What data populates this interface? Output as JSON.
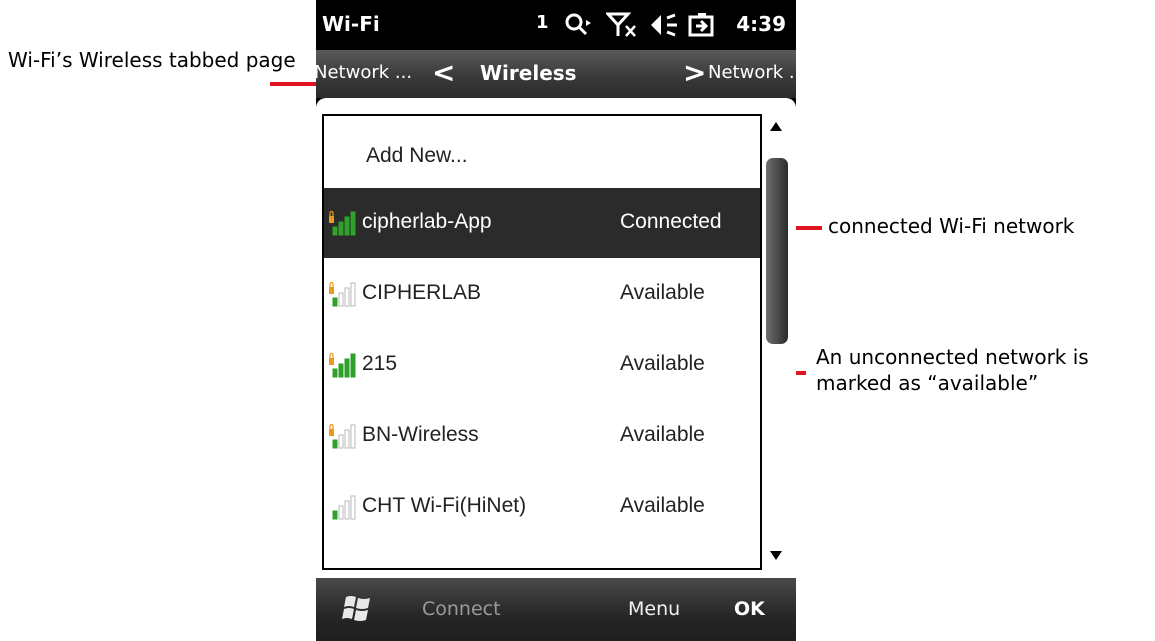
{
  "annotations": {
    "tab_page": "Wi-Fi’s Wireless tabbed page",
    "connected": "connected Wi-Fi network",
    "unconnected": "An unconnected network is marked as “available”"
  },
  "statusbar": {
    "title": "Wi-Fi",
    "signal_indicator": "1",
    "time": "4:39",
    "icons": [
      "connectivity-icon",
      "no-signal-icon",
      "volume-icon",
      "battery-charging-icon"
    ]
  },
  "tabs": {
    "prev_label": "Network ...",
    "active_label": "Wireless",
    "next_label": "Network ..."
  },
  "list": {
    "add_new_label": "Add New...",
    "networks": [
      {
        "ssid": "cipherlab-App",
        "status": "Connected",
        "selected": true,
        "secured": true,
        "signal_bars": 4
      },
      {
        "ssid": "CIPHERLAB",
        "status": "Available",
        "selected": false,
        "secured": true,
        "signal_bars": 1
      },
      {
        "ssid": "215",
        "status": "Available",
        "selected": false,
        "secured": true,
        "signal_bars": 4
      },
      {
        "ssid": "BN-Wireless",
        "status": "Available",
        "selected": false,
        "secured": true,
        "signal_bars": 1
      },
      {
        "ssid": "CHT Wi-Fi(HiNet)",
        "status": "Available",
        "selected": false,
        "secured": false,
        "signal_bars": 1
      }
    ]
  },
  "menubar": {
    "connect_label": "Connect",
    "menu_label": "Menu",
    "ok_label": "OK"
  },
  "colors": {
    "annotation_red": "#e0141e",
    "signal_green": "#2fa12a",
    "lock_orange": "#e89a1e",
    "selected_row": "#2b2b2b"
  }
}
